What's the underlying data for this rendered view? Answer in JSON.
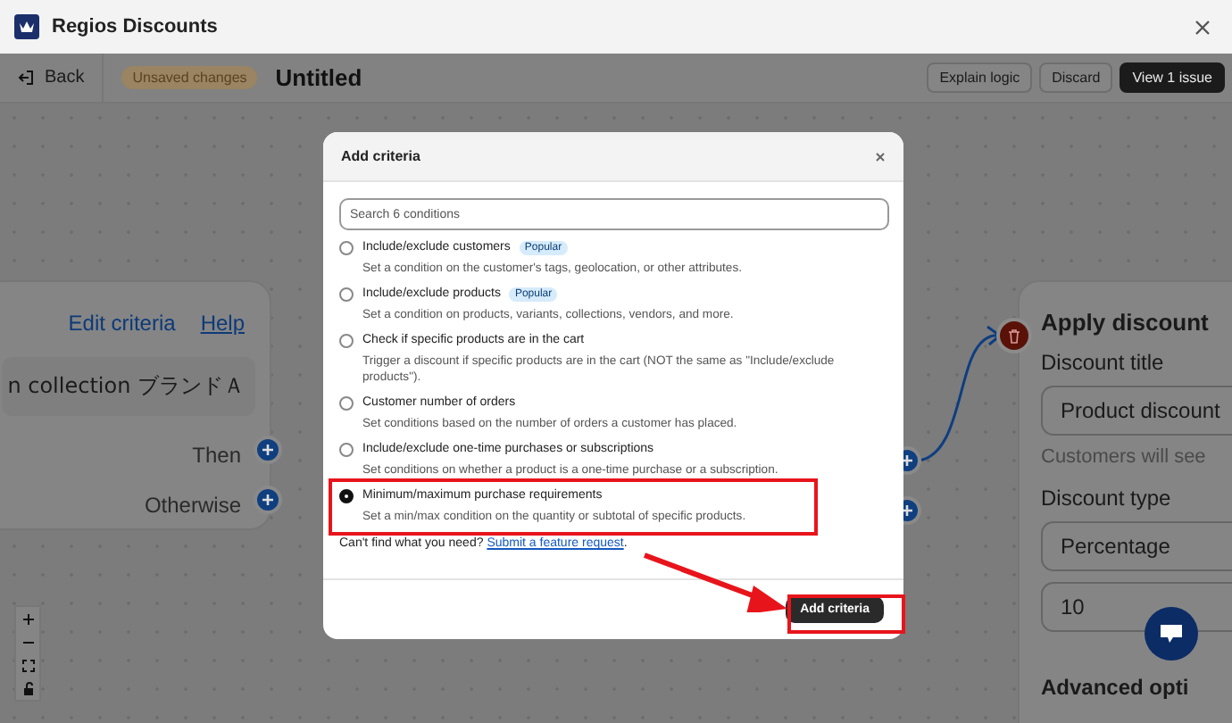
{
  "window": {
    "title": "Regios Discounts"
  },
  "toolbar": {
    "back": "Back",
    "badge": "Unsaved changes",
    "title": "Untitled",
    "buttons": [
      {
        "label": "Explain logic",
        "kind": "secondary"
      },
      {
        "label": "Discard",
        "kind": "secondary"
      },
      {
        "label": "View 1 issue",
        "kind": "primary"
      }
    ]
  },
  "condition_node": {
    "links": [
      "Edit criteria",
      "Help"
    ],
    "condition": "n collection ブランドＡ",
    "outputs": [
      "Then",
      "Otherwise"
    ]
  },
  "action_node": {
    "title": "Apply discount",
    "title_label": "Discount title",
    "title_value": "Product discount",
    "title_help": "Customers will see",
    "type_label": "Discount type",
    "type_value": "Percentage",
    "amount_value": "10",
    "advanced": "Advanced opti"
  },
  "modal": {
    "title": "Add criteria",
    "search": {
      "placeholder": "Search 6 conditions"
    },
    "options": [
      {
        "label": "Include/exclude customers",
        "badge": "Popular",
        "description": "Set a condition on the customer's tags, geolocation, or other attributes.",
        "selected": false
      },
      {
        "label": "Include/exclude products",
        "badge": "Popular",
        "description": "Set a condition on products, variants, collections, vendors, and more.",
        "selected": false
      },
      {
        "label": "Check if specific products are in the cart",
        "description": "Trigger a discount if specific products are in the cart (NOT the same as \"Include/exclude products\").",
        "selected": false
      },
      {
        "label": "Customer number of orders",
        "description": "Set conditions based on the number of orders a customer has placed.",
        "selected": false
      },
      {
        "label": "Include/exclude one-time purchases or subscriptions",
        "description": "Set conditions on whether a product is a one-time purchase or a subscription.",
        "selected": false
      },
      {
        "label": "Minimum/maximum purchase requirements",
        "description": "Set a min/max condition on the quantity or subtotal of specific products.",
        "selected": true
      }
    ],
    "footer_text": "Can't find what you need?",
    "footer_link": "Submit a feature request",
    "footer_end": ".",
    "button": "Add criteria"
  }
}
